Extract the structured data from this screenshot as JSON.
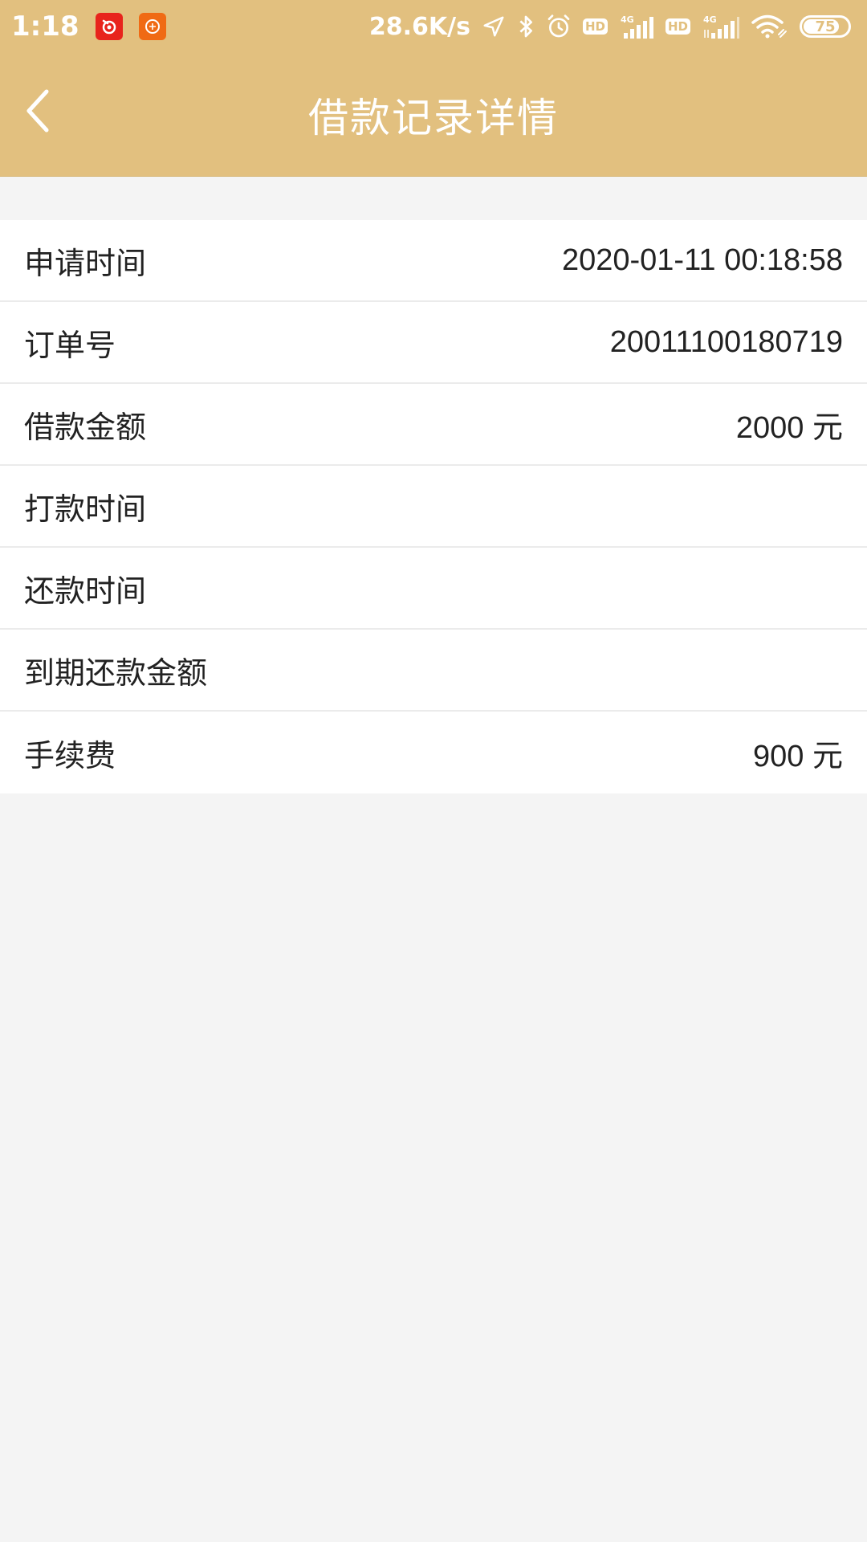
{
  "status_bar": {
    "time": "1:18",
    "net_speed": "28.6K/s",
    "hd_badge_1": "HD",
    "hd_badge_2": "HD",
    "signal_1_label": "4G",
    "signal_2_label": "4G",
    "battery_level": "75",
    "colors": {
      "bar": "#e2c07f",
      "foreground": "#ffffff"
    },
    "icons": [
      "app-notification-icon",
      "app-notification-icon",
      "location-icon",
      "bluetooth-icon",
      "alarm-icon",
      "signal-icon",
      "signal-icon",
      "wifi-icon",
      "battery-icon"
    ]
  },
  "app_bar": {
    "title": "借款记录详情",
    "back_icon": "chevron-left-icon",
    "color": "#e2c07f"
  },
  "details": {
    "rows": [
      {
        "label": "申请时间",
        "value": "2020-01-11 00:18:58"
      },
      {
        "label": "订单号",
        "value": "20011100180719"
      },
      {
        "label": "借款金额",
        "value": "2000 元"
      },
      {
        "label": "打款时间",
        "value": ""
      },
      {
        "label": "还款时间",
        "value": ""
      },
      {
        "label": "到期还款金额",
        "value": ""
      },
      {
        "label": "手续费",
        "value": "900 元"
      }
    ]
  }
}
